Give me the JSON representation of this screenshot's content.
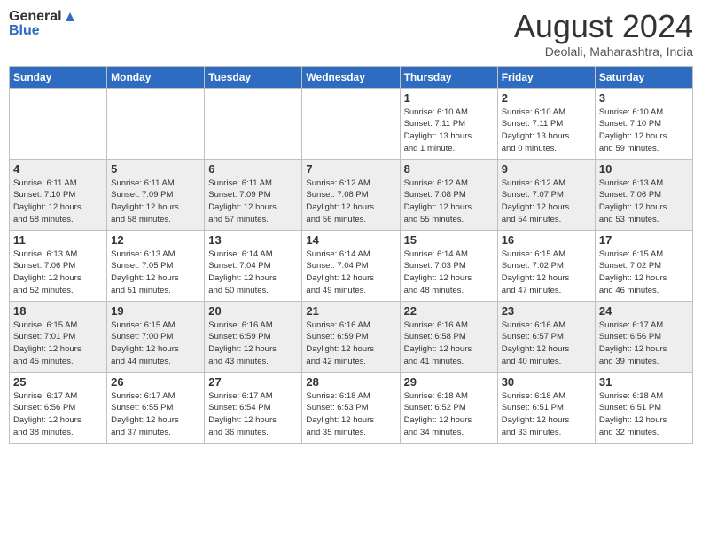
{
  "header": {
    "logo_line1": "General",
    "logo_line2": "Blue",
    "month": "August 2024",
    "location": "Deolali, Maharashtra, India"
  },
  "days_of_week": [
    "Sunday",
    "Monday",
    "Tuesday",
    "Wednesday",
    "Thursday",
    "Friday",
    "Saturday"
  ],
  "weeks": [
    [
      {
        "day": "",
        "info": ""
      },
      {
        "day": "",
        "info": ""
      },
      {
        "day": "",
        "info": ""
      },
      {
        "day": "",
        "info": ""
      },
      {
        "day": "1",
        "info": "Sunrise: 6:10 AM\nSunset: 7:11 PM\nDaylight: 13 hours\nand 1 minute."
      },
      {
        "day": "2",
        "info": "Sunrise: 6:10 AM\nSunset: 7:11 PM\nDaylight: 13 hours\nand 0 minutes."
      },
      {
        "day": "3",
        "info": "Sunrise: 6:10 AM\nSunset: 7:10 PM\nDaylight: 12 hours\nand 59 minutes."
      }
    ],
    [
      {
        "day": "4",
        "info": "Sunrise: 6:11 AM\nSunset: 7:10 PM\nDaylight: 12 hours\nand 58 minutes."
      },
      {
        "day": "5",
        "info": "Sunrise: 6:11 AM\nSunset: 7:09 PM\nDaylight: 12 hours\nand 58 minutes."
      },
      {
        "day": "6",
        "info": "Sunrise: 6:11 AM\nSunset: 7:09 PM\nDaylight: 12 hours\nand 57 minutes."
      },
      {
        "day": "7",
        "info": "Sunrise: 6:12 AM\nSunset: 7:08 PM\nDaylight: 12 hours\nand 56 minutes."
      },
      {
        "day": "8",
        "info": "Sunrise: 6:12 AM\nSunset: 7:08 PM\nDaylight: 12 hours\nand 55 minutes."
      },
      {
        "day": "9",
        "info": "Sunrise: 6:12 AM\nSunset: 7:07 PM\nDaylight: 12 hours\nand 54 minutes."
      },
      {
        "day": "10",
        "info": "Sunrise: 6:13 AM\nSunset: 7:06 PM\nDaylight: 12 hours\nand 53 minutes."
      }
    ],
    [
      {
        "day": "11",
        "info": "Sunrise: 6:13 AM\nSunset: 7:06 PM\nDaylight: 12 hours\nand 52 minutes."
      },
      {
        "day": "12",
        "info": "Sunrise: 6:13 AM\nSunset: 7:05 PM\nDaylight: 12 hours\nand 51 minutes."
      },
      {
        "day": "13",
        "info": "Sunrise: 6:14 AM\nSunset: 7:04 PM\nDaylight: 12 hours\nand 50 minutes."
      },
      {
        "day": "14",
        "info": "Sunrise: 6:14 AM\nSunset: 7:04 PM\nDaylight: 12 hours\nand 49 minutes."
      },
      {
        "day": "15",
        "info": "Sunrise: 6:14 AM\nSunset: 7:03 PM\nDaylight: 12 hours\nand 48 minutes."
      },
      {
        "day": "16",
        "info": "Sunrise: 6:15 AM\nSunset: 7:02 PM\nDaylight: 12 hours\nand 47 minutes."
      },
      {
        "day": "17",
        "info": "Sunrise: 6:15 AM\nSunset: 7:02 PM\nDaylight: 12 hours\nand 46 minutes."
      }
    ],
    [
      {
        "day": "18",
        "info": "Sunrise: 6:15 AM\nSunset: 7:01 PM\nDaylight: 12 hours\nand 45 minutes."
      },
      {
        "day": "19",
        "info": "Sunrise: 6:15 AM\nSunset: 7:00 PM\nDaylight: 12 hours\nand 44 minutes."
      },
      {
        "day": "20",
        "info": "Sunrise: 6:16 AM\nSunset: 6:59 PM\nDaylight: 12 hours\nand 43 minutes."
      },
      {
        "day": "21",
        "info": "Sunrise: 6:16 AM\nSunset: 6:59 PM\nDaylight: 12 hours\nand 42 minutes."
      },
      {
        "day": "22",
        "info": "Sunrise: 6:16 AM\nSunset: 6:58 PM\nDaylight: 12 hours\nand 41 minutes."
      },
      {
        "day": "23",
        "info": "Sunrise: 6:16 AM\nSunset: 6:57 PM\nDaylight: 12 hours\nand 40 minutes."
      },
      {
        "day": "24",
        "info": "Sunrise: 6:17 AM\nSunset: 6:56 PM\nDaylight: 12 hours\nand 39 minutes."
      }
    ],
    [
      {
        "day": "25",
        "info": "Sunrise: 6:17 AM\nSunset: 6:56 PM\nDaylight: 12 hours\nand 38 minutes."
      },
      {
        "day": "26",
        "info": "Sunrise: 6:17 AM\nSunset: 6:55 PM\nDaylight: 12 hours\nand 37 minutes."
      },
      {
        "day": "27",
        "info": "Sunrise: 6:17 AM\nSunset: 6:54 PM\nDaylight: 12 hours\nand 36 minutes."
      },
      {
        "day": "28",
        "info": "Sunrise: 6:18 AM\nSunset: 6:53 PM\nDaylight: 12 hours\nand 35 minutes."
      },
      {
        "day": "29",
        "info": "Sunrise: 6:18 AM\nSunset: 6:52 PM\nDaylight: 12 hours\nand 34 minutes."
      },
      {
        "day": "30",
        "info": "Sunrise: 6:18 AM\nSunset: 6:51 PM\nDaylight: 12 hours\nand 33 minutes."
      },
      {
        "day": "31",
        "info": "Sunrise: 6:18 AM\nSunset: 6:51 PM\nDaylight: 12 hours\nand 32 minutes."
      }
    ]
  ]
}
